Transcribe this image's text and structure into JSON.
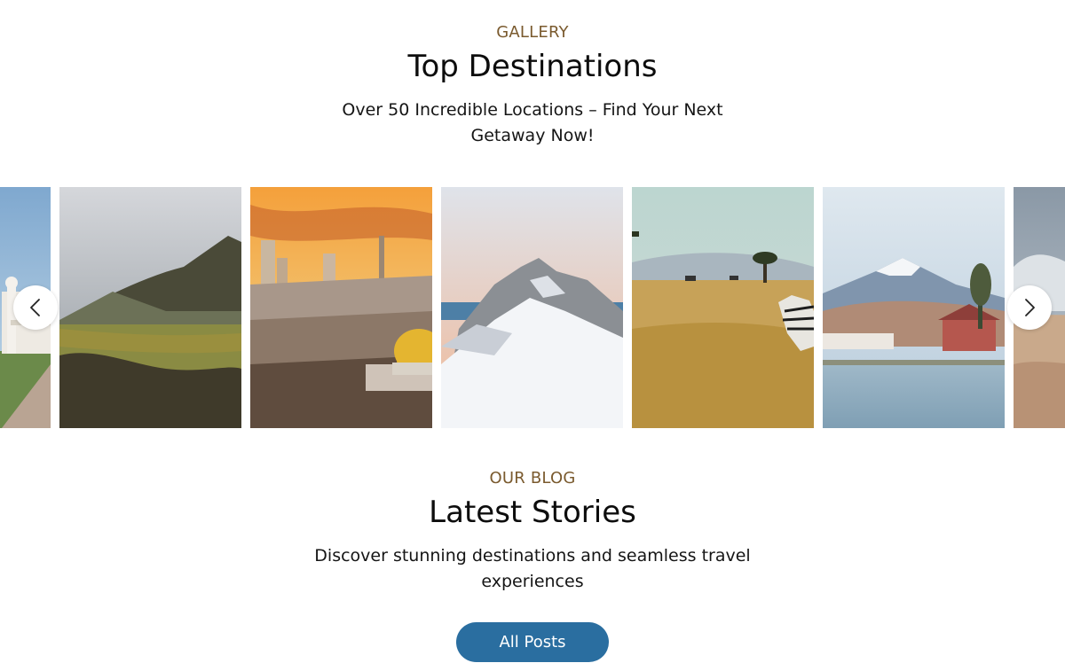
{
  "gallery": {
    "eyebrow": "GALLERY",
    "title": "Top Destinations",
    "subtitle": "Over 50 Incredible Locations – Find Your Next Getaway Now!",
    "accent_color": "#7a5a2e",
    "cards": [
      {
        "subject": "white temple with minarets and walkway"
      },
      {
        "subject": "green mountain over grassy plain"
      },
      {
        "subject": "city skyline with golden dome at sunset"
      },
      {
        "subject": "snowy mountain peak"
      },
      {
        "subject": "savanna with zebra and acacia tree"
      },
      {
        "subject": "snow-capped mountain over lakeside village"
      },
      {
        "subject": "desert dunes under cloudy sky"
      }
    ]
  },
  "controls": {
    "prev_icon": "chevron-left-icon",
    "next_icon": "chevron-right-icon"
  },
  "blog": {
    "eyebrow": "OUR BLOG",
    "title": "Latest Stories",
    "subtitle": "Discover stunning destinations and seamless travel experiences",
    "cta_label": "All Posts",
    "cta_color": "#2a6ea0"
  }
}
